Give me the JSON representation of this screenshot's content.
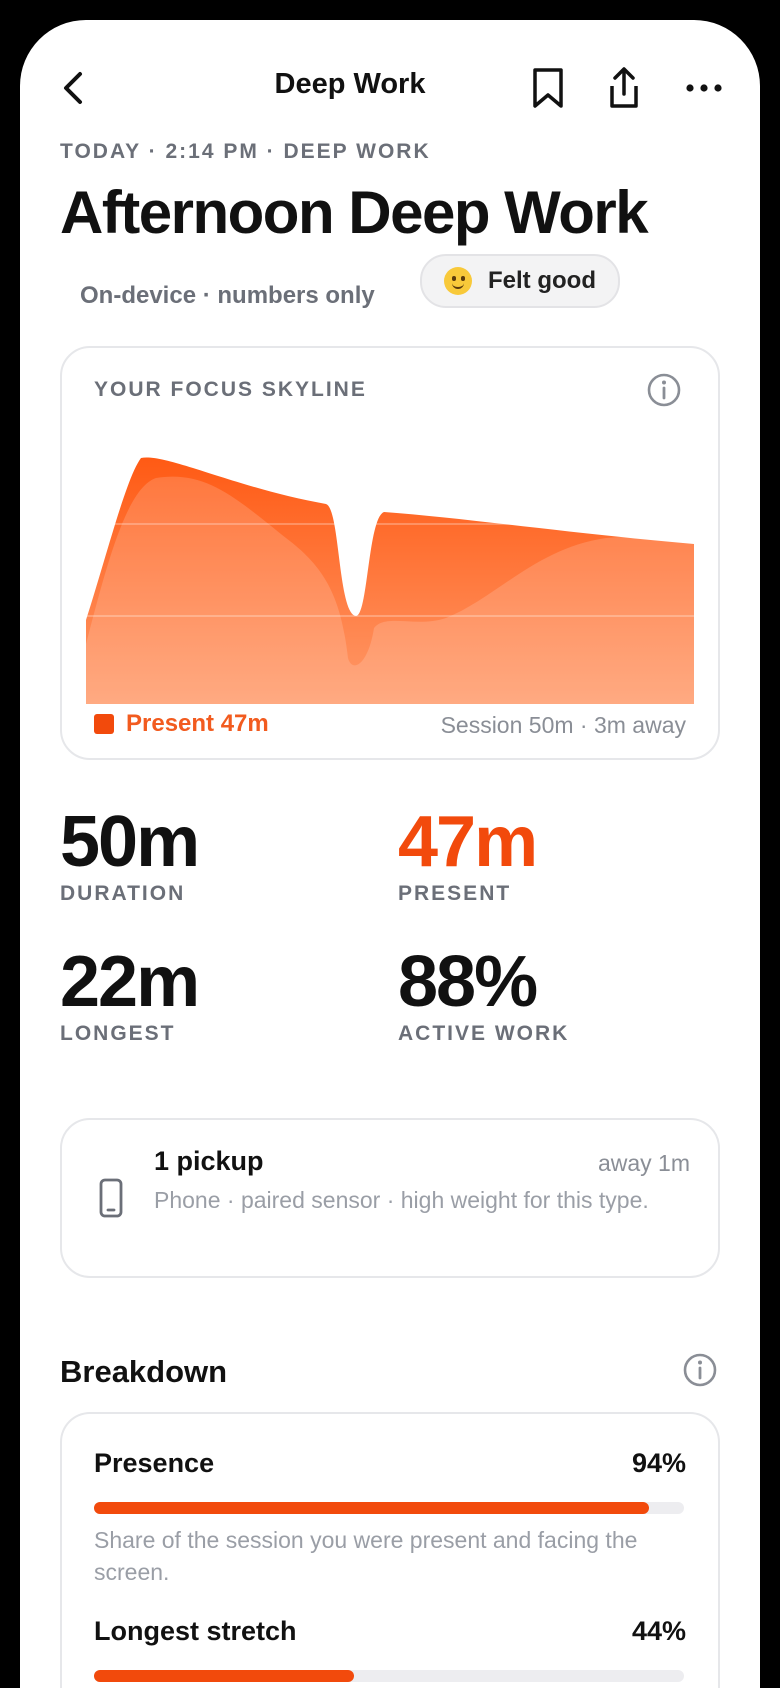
{
  "nav": {
    "title": "Deep Work"
  },
  "header": {
    "eyebrow": "TODAY · 2:14 PM · DEEP WORK",
    "title": "Afternoon Deep Work",
    "privacy": "On-device · numbers only",
    "mood": "Felt good",
    "mood_emoji": "slightly-smiling-face"
  },
  "skyline": {
    "title": "YOUR FOCUS SKYLINE",
    "legend": "Present 47m",
    "summary": "Session 50m · 3m away"
  },
  "stats": {
    "duration_value": "50m",
    "duration_label": "DURATION",
    "present_value": "47m",
    "present_label": "PRESENT",
    "longest_value": "22m",
    "longest_label": "LONGEST",
    "active_value": "88%",
    "active_label": "ACTIVE WORK"
  },
  "pickup": {
    "title": "1 pickup",
    "away": "away 1m",
    "description": "Phone · paired sensor · high weight for this type."
  },
  "breakdown": {
    "title": "Breakdown",
    "rows": [
      {
        "label": "Presence",
        "pct": "94%",
        "value": 0.94,
        "desc": "Share of the session you were present and facing the screen."
      },
      {
        "label": "Longest stretch",
        "pct": "44%",
        "value": 0.44
      }
    ]
  },
  "colors": {
    "accent": "#F24A0C",
    "muted": "#6B6F78"
  }
}
